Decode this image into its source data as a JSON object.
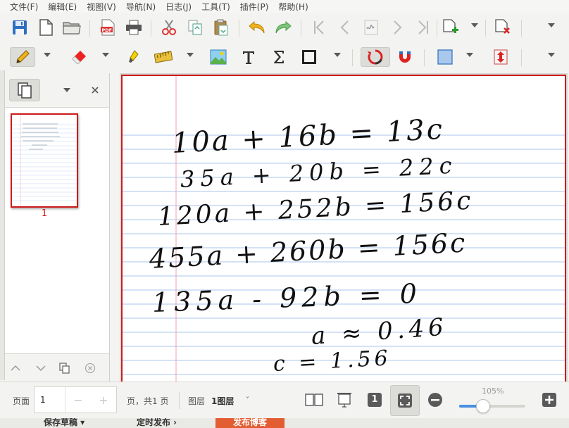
{
  "menu": [
    "文件(F)",
    "编辑(E)",
    "视图(V)",
    "导航(N)",
    "日志(J)",
    "工具(T)",
    "插件(P)",
    "帮助(H)"
  ],
  "colors": {
    "accent_red": "#cc1b1b",
    "ruled_line": "#a9c6ec",
    "margin_line": "#f0a0a8",
    "ink": "#111111",
    "publish_orange": "#e25d32"
  },
  "toolbar1": {
    "icons": [
      "save-icon",
      "new-page-icon",
      "open-folder-icon",
      "export-pdf-icon",
      "print-icon",
      "cut-icon",
      "copy-icon",
      "paste-icon",
      "undo-icon",
      "redo-icon",
      "first-page-icon",
      "previous-page-icon",
      "layer-icon",
      "next-page-icon",
      "last-page-icon",
      "add-page-icon",
      "delete-page-icon"
    ]
  },
  "toolbar2": {
    "icons": [
      "pen-icon",
      "eraser-icon",
      "highlighter-icon",
      "ruler-icon",
      "image-icon",
      "text-icon",
      "formula-icon",
      "shape-icon",
      "rotate-select-icon",
      "magnet-icon",
      "fill-color-icon",
      "vertical-space-icon"
    ]
  },
  "sidebar": {
    "page_label": "1"
  },
  "notes": {
    "lines": [
      "10a + 16b = 13c",
      "35a + 20b = 22c",
      "120a + 252b = 156c",
      "455a + 260b = 156c",
      "135a - 92b = 0",
      "a ≈ 0.46",
      "c = 1.56"
    ]
  },
  "statusbar": {
    "page_label": "页面",
    "page_value": "1",
    "minus": "−",
    "plus": "+",
    "page_total": "页，共1 页",
    "layer_label": "图层",
    "layer_value": "1图层",
    "layer_arrow": "˅",
    "zoom": "105%",
    "zoom_level": 0.36,
    "page_number_badge": "1"
  },
  "bottom_strip": {
    "save_draft": "保存草稿 ▾",
    "schedule": "定时发布 ›",
    "publish": "发布博客"
  }
}
